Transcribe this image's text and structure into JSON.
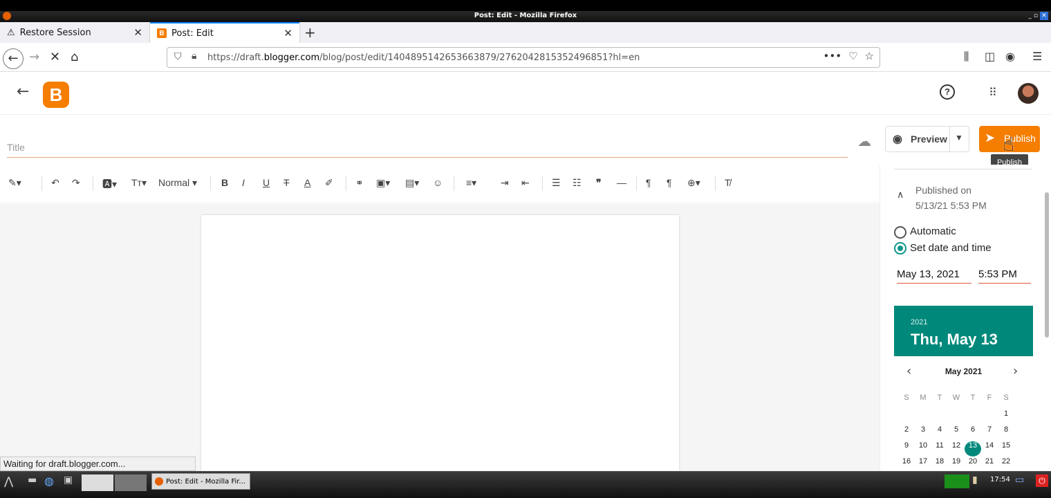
{
  "window": {
    "title": "Post: Edit - Mozilla Firefox"
  },
  "tabs": [
    {
      "label": "Restore Session"
    },
    {
      "label": "Post: Edit"
    }
  ],
  "navbar": {
    "url_prefix": "https://draft.",
    "url_domain": "blogger.com",
    "url_rest": "/blog/post/edit/1404895142653663879/2762042815352496851?hl=en"
  },
  "editor": {
    "title_placeholder": "Title",
    "preview_label": "Preview",
    "publish_label": "Publish",
    "publish_tooltip": "Publish",
    "format_select": "Normal"
  },
  "sidebar": {
    "published_on_label": "Published on",
    "published_on_value": "5/13/21 5:53 PM",
    "radio_automatic": "Automatic",
    "radio_set": "Set date and time",
    "date_value": "May 13, 2021",
    "time_value": "5:53 PM",
    "calendar": {
      "year": "2021",
      "selected_long": "Thu, May 13",
      "month_label": "May 2021",
      "dow": [
        "S",
        "M",
        "T",
        "W",
        "T",
        "F",
        "S"
      ],
      "selected_day": "13"
    }
  },
  "status_text": "Waiting for draft.blogger.com...",
  "taskbar": {
    "task_label": "Post: Edit - Mozilla Fir...",
    "clock": "17:54"
  },
  "colors": {
    "accent": "#f57d00",
    "teal": "#00897b",
    "link_blue": "#0a84ff"
  }
}
